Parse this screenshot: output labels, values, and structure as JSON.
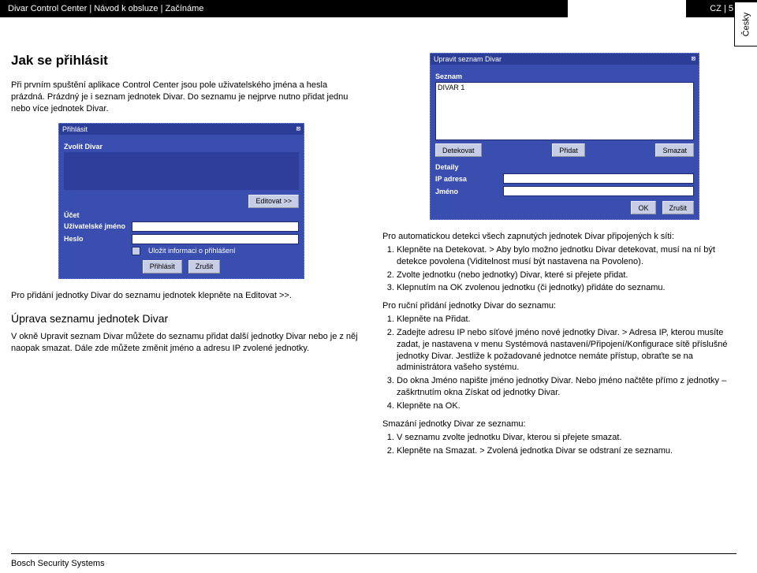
{
  "header": {
    "breadcrumb": "Divar Control Center | Návod k obsluze | Začínáme",
    "page_ref": "CZ | 5",
    "side_tab": "Česky"
  },
  "left": {
    "title": "Jak se přihlásit",
    "intro": "Při prvním spuštění aplikace Control Center jsou pole uživatelského jména a hesla prázdná. Prázdný je i seznam jednotek Divar. Do seznamu je nejprve nutno přidat jednu nebo více jednotek Divar.",
    "login_window": {
      "title": "Přihlásit",
      "choose_label": "Zvolit Divar",
      "edit_btn": "Editovat >>",
      "account_label": "Účet",
      "user_label": "Uživatelské jméno",
      "pass_label": "Heslo",
      "remember": "Uložit informaci o přihlášení",
      "login_btn": "Přihlásit",
      "cancel_btn": "Zrušit"
    },
    "after_login": "Pro přidání jednotky Divar do seznamu jednotek klepněte na Editovat >>.",
    "subtitle": "Úprava seznamu jednotek Divar",
    "subpara": "V okně Upravit seznam Divar můžete do seznamu přidat další jednotky Divar nebo je z něj naopak smazat. Dále zde můžete změnit jméno a adresu IP zvolené jednotky."
  },
  "right": {
    "edit_window": {
      "title": "Upravit seznam Divar",
      "list_label": "Seznam",
      "list_item": "DIVAR 1",
      "detect_btn": "Detekovat",
      "add_btn": "Přidat",
      "del_btn": "Smazat",
      "details_label": "Detaily",
      "ip_label": "IP adresa",
      "name_label": "Jméno",
      "ok_btn": "OK",
      "cancel_btn": "Zrušit"
    },
    "auto_heading": "Pro automatickou detekci všech zapnutých jednotek Divar připojených k síti:",
    "auto_list": [
      "Klepněte na Detekovat.",
      "Zvolte jednotku (nebo jednotky) Divar, které si přejete přidat.",
      "Klepnutím na OK zvolenou jednotku (či jednotky) přidáte do seznamu."
    ],
    "auto_sub1": "> Aby bylo možno jednotku Divar detekovat, musí na ní být detekce povolena (Viditelnost musí být nastavena na Povoleno).",
    "manual_heading": "Pro ruční přidání jednotky Divar do seznamu:",
    "manual_list": [
      "Klepněte na Přidat.",
      "Zadejte adresu IP nebo síťové jméno nové jednotky Divar.",
      "Do okna Jméno napište jméno jednotky Divar. Nebo jméno načtěte přímo z jednotky – zaškrtnutím okna Získat od jednotky Divar.",
      "Klepněte na OK."
    ],
    "manual_sub2": "> Adresa IP, kterou musíte zadat, je nastavena v menu Systémová nastavení/Připojení/Konfigurace sítě příslušné jednotky Divar. Jestliže k požadované jednotce nemáte přístup, obraťte se na administrátora vašeho systému.",
    "delete_heading": "Smazání jednotky Divar ze seznamu:",
    "delete_list": [
      "V seznamu zvolte jednotku Divar, kterou si přejete smazat.",
      "Klepněte na Smazat."
    ],
    "delete_sub": "> Zvolená jednotka Divar se odstraní ze seznamu."
  },
  "footer": "Bosch Security Systems"
}
